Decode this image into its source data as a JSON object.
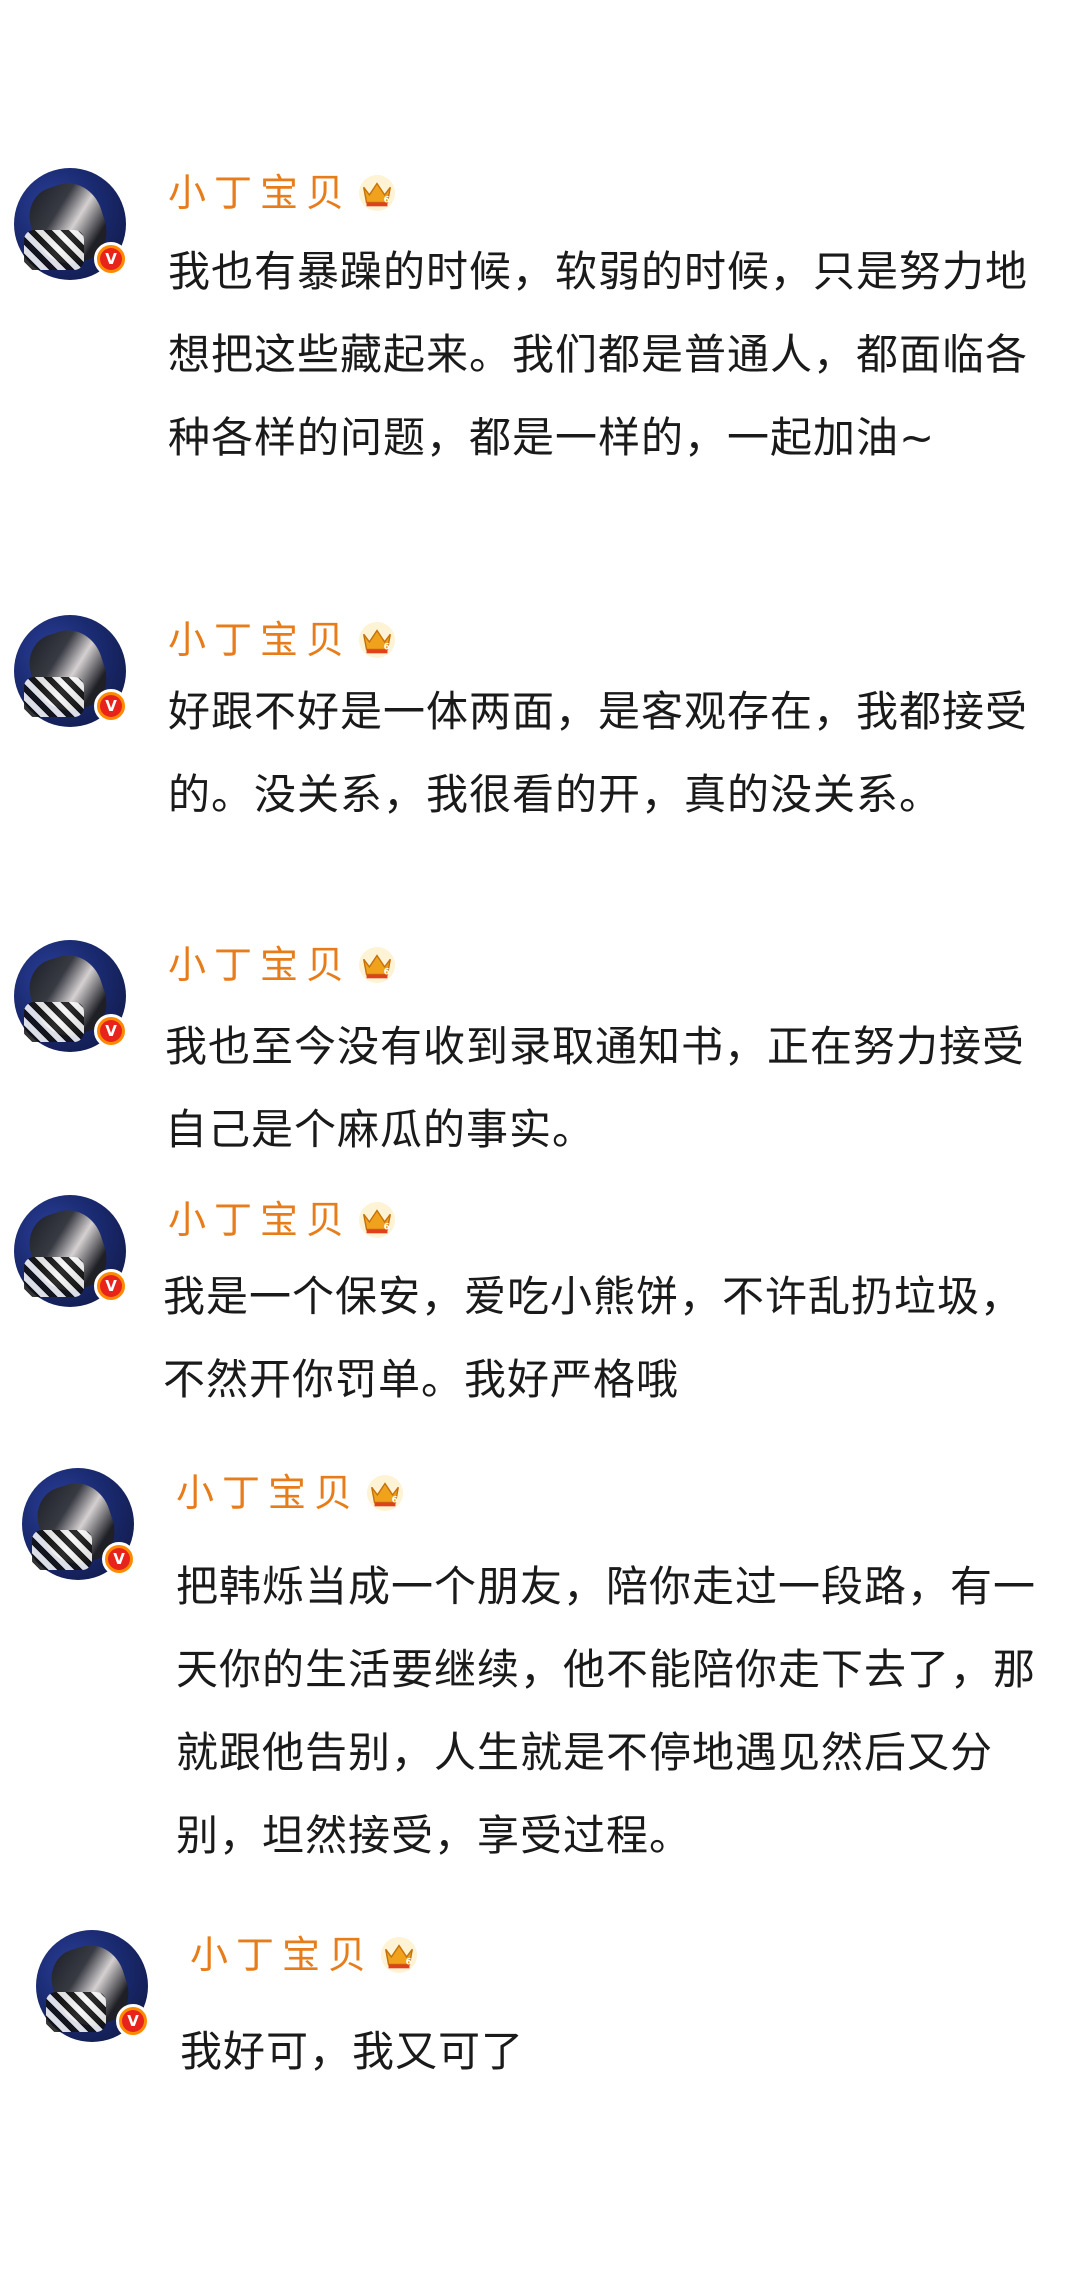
{
  "comments": [
    {
      "username": "小丁宝贝",
      "text": "我也有暴躁的时候，软弱的时候，只是努力地想把这些藏起来。我们都是普通人，都面临各种各样的问题，都是一样的，一起加油~",
      "avatar_icon": "avatar-portrait",
      "badge_icon": "verified-v-icon",
      "level_icon": "crown-level-icon"
    },
    {
      "username": "小丁宝贝",
      "text": "好跟不好是一体两面，是客观存在，我都接受的。没关系，我很看的开，真的没关系。",
      "avatar_icon": "avatar-portrait",
      "badge_icon": "verified-v-icon",
      "level_icon": "crown-level-icon"
    },
    {
      "username": "小丁宝贝",
      "text": "我也至今没有收到录取通知书，正在努力接受自己是个麻瓜的事实。",
      "avatar_icon": "avatar-portrait",
      "badge_icon": "verified-v-icon",
      "level_icon": "crown-level-icon"
    },
    {
      "username": "小丁宝贝",
      "text": "我是一个保安，爱吃小熊饼，不许乱扔垃圾，不然开你罚单。我好严格哦",
      "avatar_icon": "avatar-portrait",
      "badge_icon": "verified-v-icon",
      "level_icon": "crown-level-icon"
    },
    {
      "username": "小丁宝贝",
      "text": "把韩烁当成一个朋友，陪你走过一段路，有一天你的生活要继续，他不能陪你走下去了，那就跟他告别，人生就是不停地遇见然后又分别，坦然接受，享受过程。",
      "avatar_icon": "avatar-portrait",
      "badge_icon": "verified-v-icon",
      "level_icon": "crown-level-icon"
    },
    {
      "username": "小丁宝贝",
      "text": "我好可，我又可了",
      "avatar_icon": "avatar-portrait",
      "badge_icon": "verified-v-icon",
      "level_icon": "crown-level-icon"
    }
  ],
  "colors": {
    "username": "#e77c1a",
    "text": "#1a1a1a",
    "verified_badge": "#e8231c",
    "badge_ring": "#ff8a00",
    "crown": "#f0a21c"
  },
  "badge_letter": "V"
}
